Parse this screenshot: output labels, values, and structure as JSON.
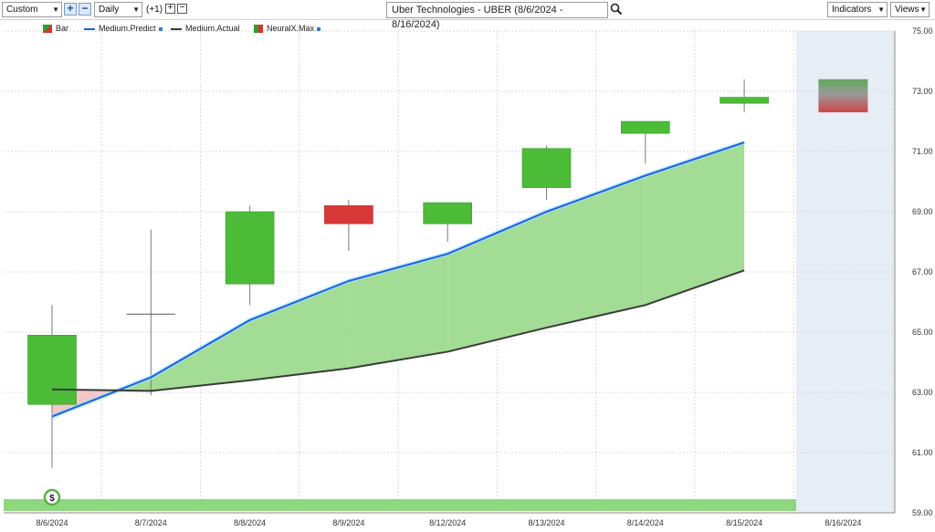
{
  "toolbar": {
    "range_select": "Custom",
    "interval_select": "Daily",
    "offset_label": "(+1)",
    "title": "Uber Technologies - UBER (8/6/2024 - 8/16/2024)",
    "indicators_label": "Indicators",
    "views_label": "Views"
  },
  "legend": [
    {
      "label": "Bar",
      "color": "#2e9e2e"
    },
    {
      "label": "Medium.Predict",
      "color": "#1f5fe0"
    },
    {
      "label": "Medium.Actual",
      "color": "#3a3a3a"
    },
    {
      "label": "NeuralX.Max",
      "color": "#d93030"
    }
  ],
  "colors": {
    "up": "#4cbb38",
    "down": "#d93838",
    "predict": "#1f5fe0",
    "actual": "#3a3a3a",
    "fill_above": "#a3dc94",
    "fill_below": "#f2c8c8",
    "forecast_bg": "#e6edf5",
    "bottom_band": "#8ed77f"
  },
  "marker_label": "$",
  "chart_data": {
    "type": "candlestick",
    "title": "Uber Technologies - UBER (8/6/2024 - 8/16/2024)",
    "categories": [
      "8/6/2024",
      "8/7/2024",
      "8/8/2024",
      "8/9/2024",
      "8/12/2024",
      "8/13/2024",
      "8/14/2024",
      "8/15/2024",
      "8/16/2024"
    ],
    "ylim": [
      59.0,
      75.0
    ],
    "yticks": [
      "59.00",
      "61.00",
      "63.00",
      "65.00",
      "67.00",
      "69.00",
      "71.00",
      "73.00",
      "75.00"
    ],
    "grid": true,
    "candles": [
      {
        "date": "8/6/2024",
        "open": 62.6,
        "high": 65.9,
        "low": 60.5,
        "close": 64.9
      },
      {
        "date": "8/7/2024",
        "open": 65.6,
        "high": 68.4,
        "low": 62.9,
        "close": 65.6
      },
      {
        "date": "8/8/2024",
        "open": 66.6,
        "high": 69.2,
        "low": 65.9,
        "close": 69.0
      },
      {
        "date": "8/9/2024",
        "open": 69.2,
        "high": 69.4,
        "low": 67.7,
        "close": 68.6
      },
      {
        "date": "8/12/2024",
        "open": 68.6,
        "high": 69.3,
        "low": 68.0,
        "close": 69.3
      },
      {
        "date": "8/13/2024",
        "open": 69.8,
        "high": 71.2,
        "low": 69.4,
        "close": 71.1
      },
      {
        "date": "8/14/2024",
        "open": 71.6,
        "high": 72.0,
        "low": 70.6,
        "close": 72.0
      },
      {
        "date": "8/15/2024",
        "open": 72.6,
        "high": 73.4,
        "low": 72.3,
        "close": 72.8
      }
    ],
    "forecast": {
      "date": "8/16/2024",
      "high": 73.4,
      "low": 72.3
    },
    "series": [
      {
        "name": "Medium.Predict",
        "values": [
          62.2,
          63.5,
          65.4,
          66.7,
          67.6,
          69.0,
          70.2,
          71.3
        ]
      },
      {
        "name": "Medium.Actual",
        "values": [
          63.1,
          63.05,
          63.4,
          63.8,
          64.35,
          65.15,
          65.9,
          67.05
        ]
      }
    ]
  }
}
